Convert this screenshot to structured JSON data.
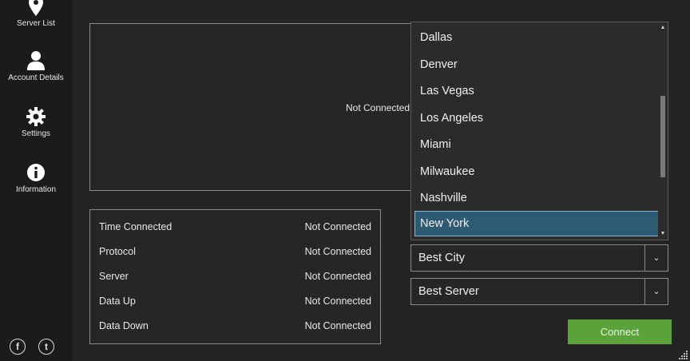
{
  "sidebar": {
    "items": [
      {
        "label": "Server List",
        "icon": "map-pin-icon"
      },
      {
        "label": "Account Details",
        "icon": "user-icon"
      },
      {
        "label": "Settings",
        "icon": "gear-icon"
      },
      {
        "label": "Information",
        "icon": "info-icon"
      }
    ],
    "social": [
      {
        "icon": "facebook-icon",
        "glyph": "f"
      },
      {
        "icon": "twitter-icon",
        "glyph": "t"
      }
    ]
  },
  "map": {
    "status": "Not Connected"
  },
  "stats": [
    {
      "label": "Time Connected",
      "value": "Not Connected"
    },
    {
      "label": "Protocol",
      "value": "Not Connected"
    },
    {
      "label": "Server",
      "value": "Not Connected"
    },
    {
      "label": "Data Up",
      "value": "Not Connected"
    },
    {
      "label": "Data Down",
      "value": "Not Connected"
    }
  ],
  "city_dropdown": {
    "options": [
      "Dallas",
      "Denver",
      "Las Vegas",
      "Los Angeles",
      "Miami",
      "Milwaukee",
      "Nashville",
      "New York"
    ],
    "highlighted": "New York",
    "selected_value": "Best City"
  },
  "server_dropdown": {
    "selected_value": "Best Server"
  },
  "connect_button": {
    "label": "Connect"
  },
  "colors": {
    "accent_green": "#5ca23b",
    "highlight_blue": "#2f5a74",
    "sidebar_bg": "#1b1b1b",
    "main_bg": "#242424"
  }
}
